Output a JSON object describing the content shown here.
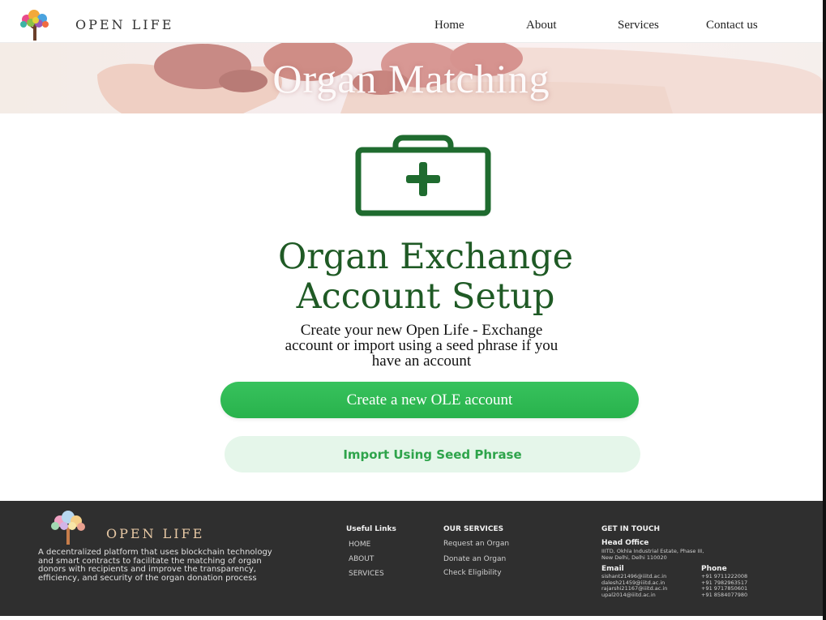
{
  "header": {
    "brand": "OPEN LIFE",
    "nav": [
      "Home",
      "About",
      "Services",
      "Contact us"
    ]
  },
  "hero": {
    "title": "Organ Matching"
  },
  "main": {
    "icon": "medical-kit-icon",
    "title_line1": "Organ Exchange",
    "title_line2": "Account Setup",
    "subtitle_line1": "Create your new Open Life - Exchange",
    "subtitle_line2": "account or import using a seed phrase if you",
    "subtitle_line3": "have an account",
    "primary_button": "Create a new OLE account",
    "secondary_button": "Import Using Seed Phrase"
  },
  "footer": {
    "brand": "OPEN LIFE",
    "description": "A decentralized platform that uses blockchain technology and smart contracts to facilitate the matching of organ donors with recipients and improve the transparency, efficiency, and security of the organ donation process",
    "useful_links_heading": "Useful Links",
    "useful_links": [
      "HOME",
      "ABOUT",
      "SERVICES"
    ],
    "services_heading": "OUR SERVICES",
    "services": [
      "Request an Organ",
      "Donate an Organ",
      "Check Eligibility"
    ],
    "contact_heading": "GET IN TOUCH",
    "head_office_label": "Head Office",
    "address_line1": "IIITD, Okhla Industrial Estate, Phase III,",
    "address_line2": "New Delhi, Delhi 110020",
    "email_label": "Email",
    "emails": [
      "sishant21496@iiitd.ac.in",
      "dalesh21459@iiitd.ac.in",
      "rajarshi21167@iiitd.ac.in",
      "upal2014@iiitd.ac.in"
    ],
    "phone_label": "Phone",
    "phones": [
      "+91 9711222008",
      "+91 7982963517",
      "+91 9717850601",
      "+91 8584077980"
    ]
  },
  "colors": {
    "accent_green": "#2db550",
    "title_green": "#1f5a25",
    "footer_bg": "#2f2f2f"
  }
}
